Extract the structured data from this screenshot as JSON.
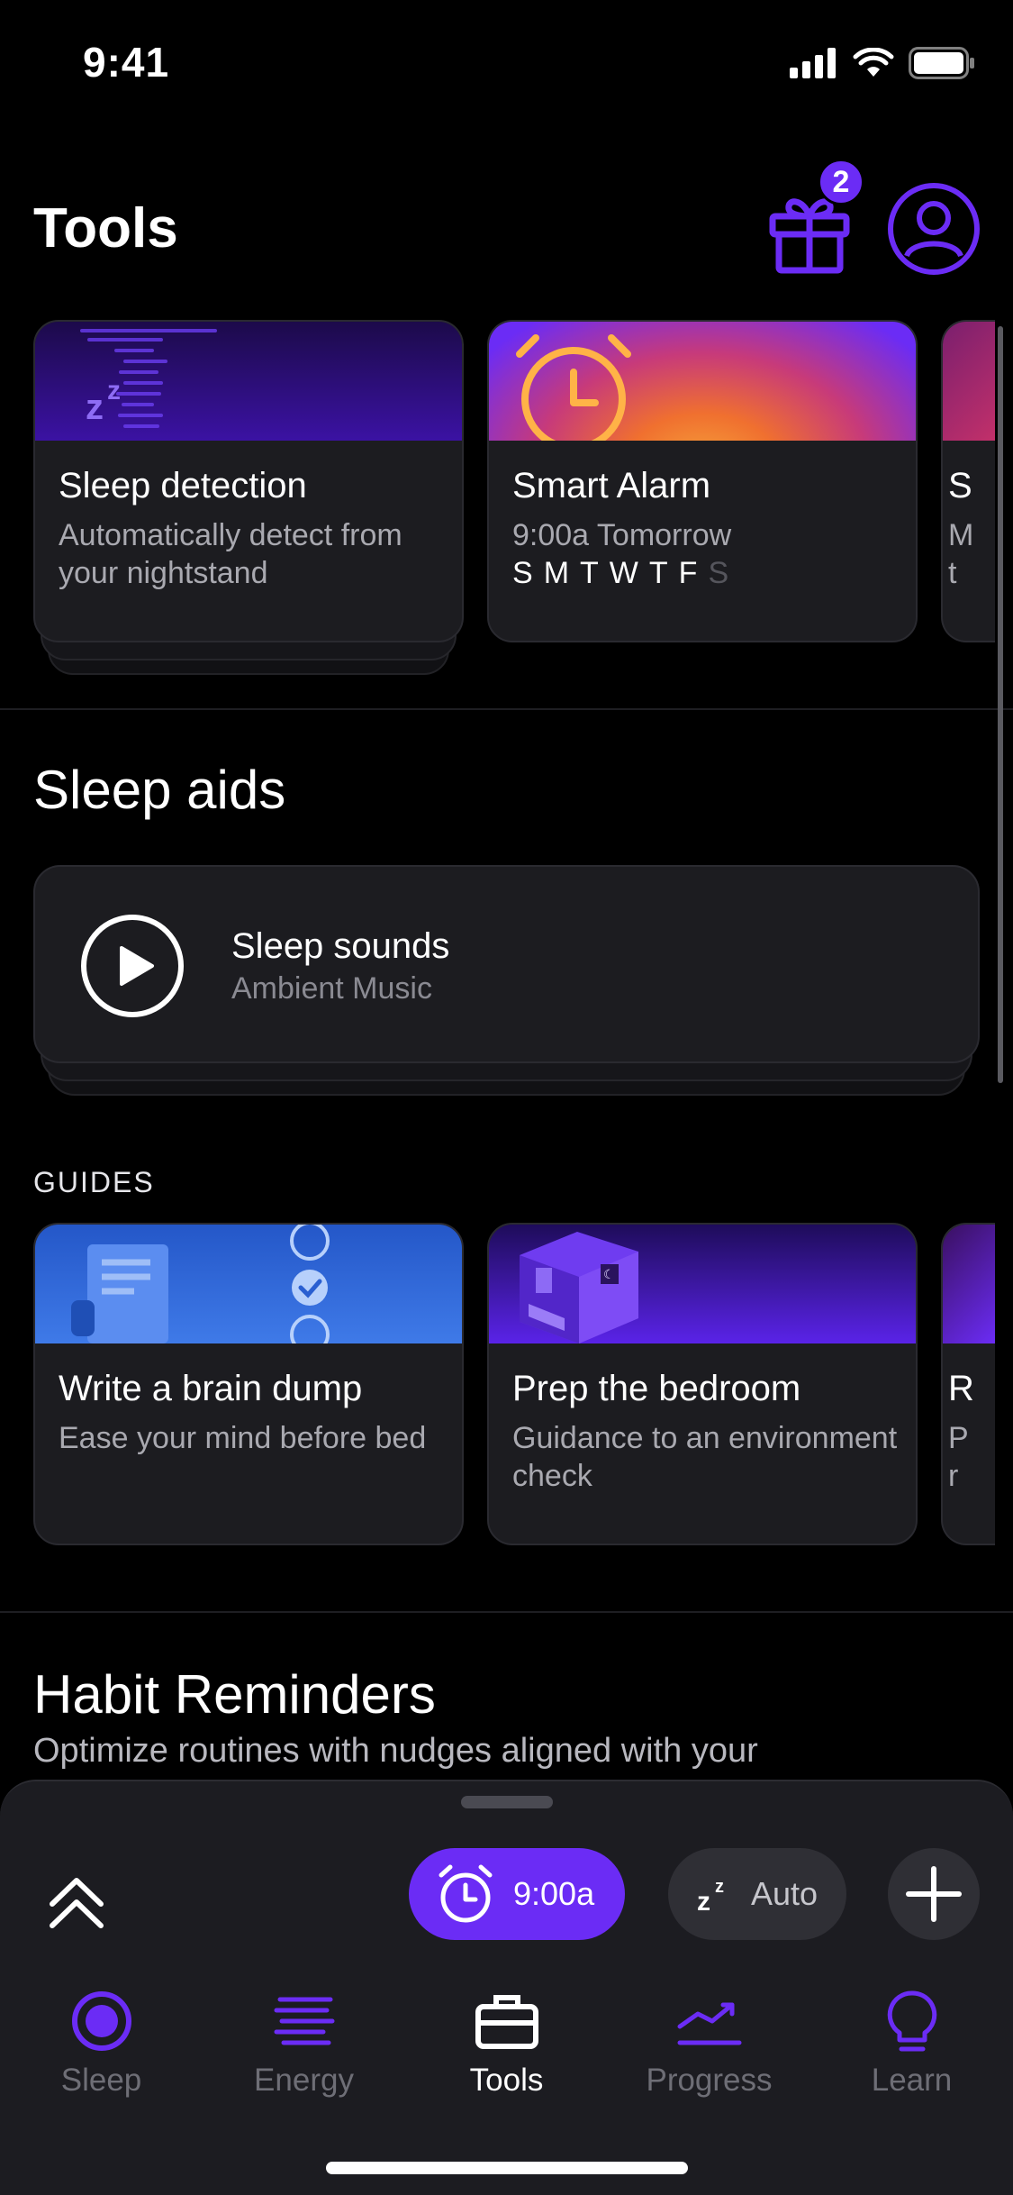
{
  "status_bar": {
    "time": "9:41"
  },
  "header": {
    "title": "Tools",
    "gift_badge_count": "2"
  },
  "tool_cards": [
    {
      "title": "Sleep detection",
      "subtitle": "Automatically detect from your nightstand",
      "icon": "zzz-icon"
    },
    {
      "title": "Smart Alarm",
      "subtitle": "9:00a Tomorrow",
      "days_on": [
        "S",
        "M",
        "T",
        "W",
        "T",
        "F"
      ],
      "days_off": [
        "S"
      ],
      "icon": "alarm-clock-icon"
    },
    {
      "title": "S",
      "subtitle": "M t"
    }
  ],
  "sleep_aids": {
    "title": "Sleep aids",
    "card": {
      "title": "Sleep sounds",
      "subtitle": "Ambient Music"
    }
  },
  "guides": {
    "label": "GUIDES",
    "cards": [
      {
        "title": "Write a brain dump",
        "subtitle": "Ease your mind before bed"
      },
      {
        "title": "Prep the bedroom",
        "subtitle": "Guidance to an environment check"
      },
      {
        "title": "R",
        "subtitle": "P r"
      }
    ]
  },
  "habit_reminders": {
    "title": "Habit Reminders",
    "subtitle": "Optimize routines with nudges aligned with your"
  },
  "bottom_sheet": {
    "alarm_label": "9:00a",
    "auto_label": "Auto"
  },
  "tabs": [
    {
      "label": "Sleep",
      "icon": "sleep-target-icon",
      "active": false
    },
    {
      "label": "Energy",
      "icon": "energy-lines-icon",
      "active": false
    },
    {
      "label": "Tools",
      "icon": "toolbox-icon",
      "active": true
    },
    {
      "label": "Progress",
      "icon": "trend-line-icon",
      "active": false
    },
    {
      "label": "Learn",
      "icon": "lightbulb-icon",
      "active": false
    }
  ],
  "colors": {
    "accent": "#6b2cf5",
    "background": "#000000",
    "card": "#1c1c20"
  }
}
